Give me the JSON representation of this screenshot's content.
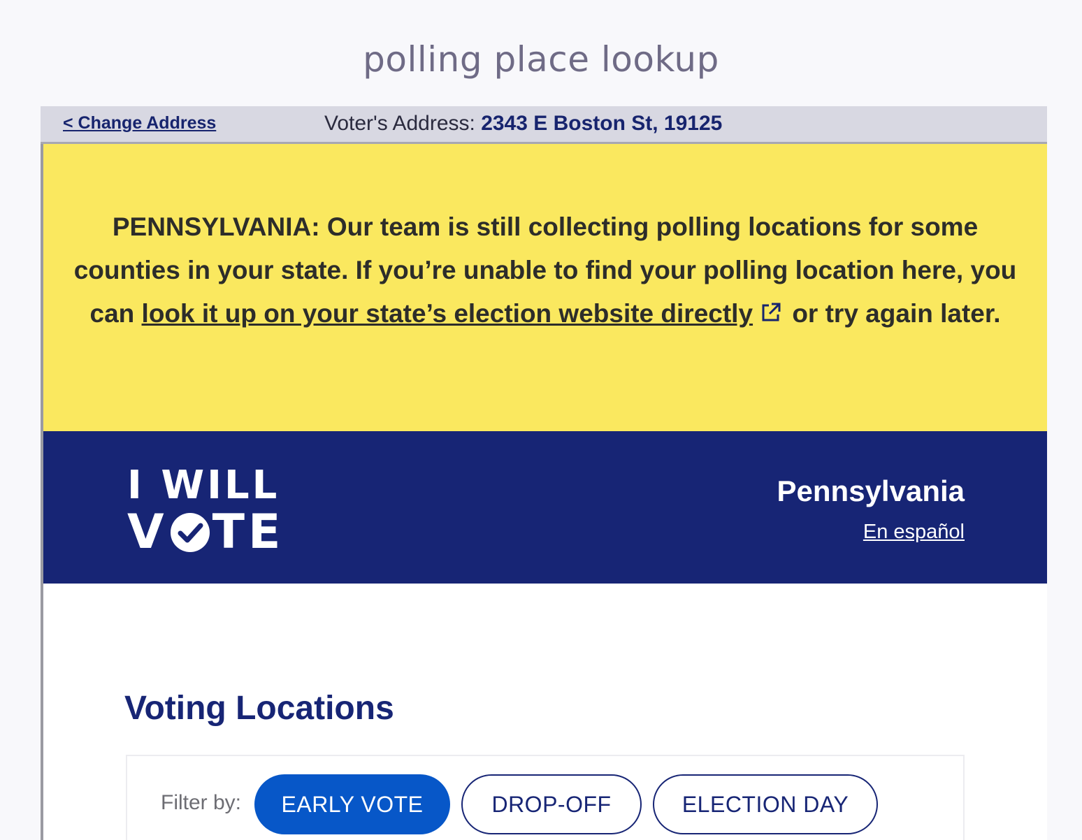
{
  "page": {
    "title": "polling place lookup"
  },
  "address_bar": {
    "change_address_label": "< Change Address",
    "voter_address_label": "Voter's Address: ",
    "voter_address_value": "2343 E Boston St, 19125"
  },
  "alert": {
    "text_before_link": "PENNSYLVANIA: Our team is still collecting polling locations for some counties in your state. If you’re unable to find your polling location here, you can ",
    "link_text": "look it up on your state’s election website directly",
    "text_after_link": " or try again later.",
    "link_icon": "external-link-icon"
  },
  "brand": {
    "logo_line1": "I WILL",
    "logo_line2_start": "V",
    "logo_line2_end": "TE",
    "logo_icon": "check-circle-icon",
    "state": "Pennsylvania",
    "language_link": "En español"
  },
  "voting": {
    "title": "Voting Locations",
    "filter_label": "Filter by:",
    "filters": [
      {
        "label": "EARLY VOTE",
        "active": true
      },
      {
        "label": "DROP-OFF",
        "active": false
      },
      {
        "label": "ELECTION DAY",
        "active": false
      }
    ]
  },
  "colors": {
    "navy": "#172575",
    "yellow": "#fae85f",
    "active_blue": "#0757c8",
    "background": "#f8f8fb"
  }
}
